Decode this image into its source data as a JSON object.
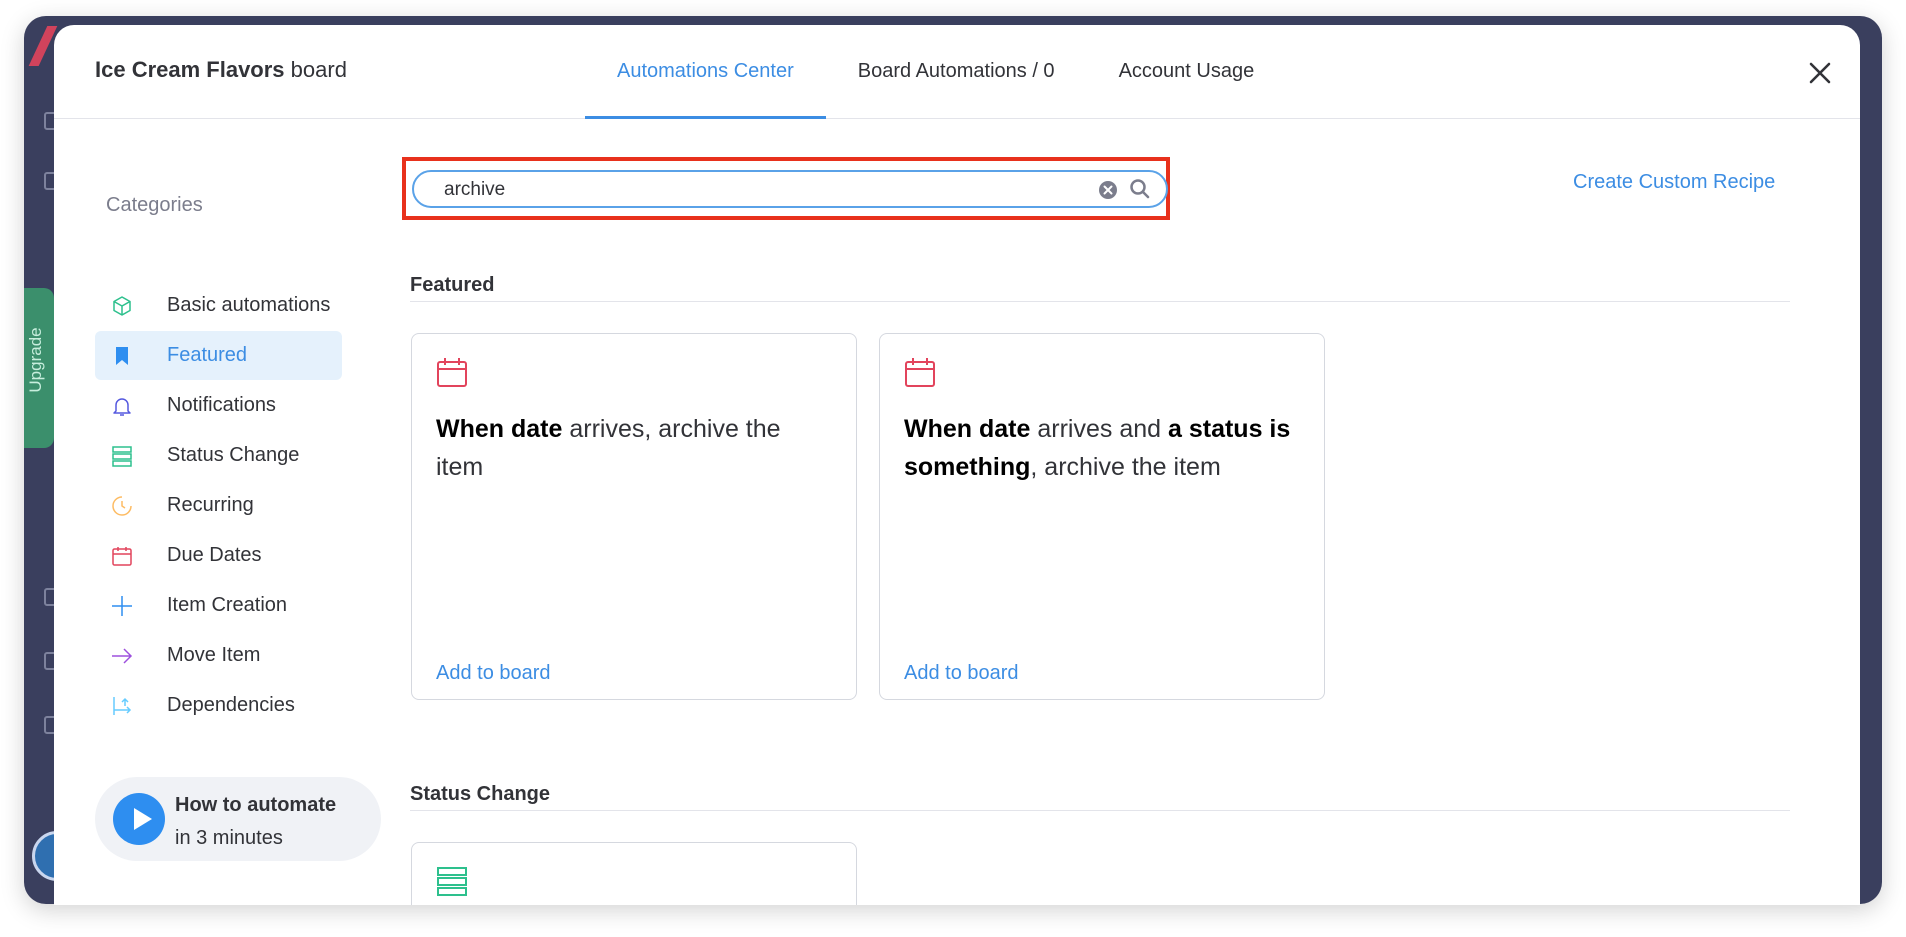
{
  "background_app": {
    "upgrade_label": "Upgrade"
  },
  "header": {
    "board_name": "Ice Cream Flavors",
    "board_suffix": "board",
    "tabs": [
      {
        "label": "Automations Center",
        "active": true
      },
      {
        "label": "Board Automations / 0",
        "active": false
      },
      {
        "label": "Account Usage",
        "active": false
      }
    ]
  },
  "sidebar": {
    "categories_label": "Categories",
    "items": [
      {
        "label": "Basic automations",
        "icon": "cube-icon",
        "color": "#2dc08d"
      },
      {
        "label": "Featured",
        "icon": "bookmark-icon",
        "color": "#2e8ef0",
        "active": true
      },
      {
        "label": "Notifications",
        "icon": "bell-icon",
        "color": "#5559df"
      },
      {
        "label": "Status Change",
        "icon": "status-stack-icon",
        "color": "#2dc08d"
      },
      {
        "label": "Recurring",
        "icon": "clock-icon",
        "color": "#fdbc64"
      },
      {
        "label": "Due Dates",
        "icon": "calendar-icon",
        "color": "#e2445c"
      },
      {
        "label": "Item Creation",
        "icon": "plus-icon",
        "color": "#2e8ef0"
      },
      {
        "label": "Move Item",
        "icon": "arrow-right-icon",
        "color": "#9d50dd"
      },
      {
        "label": "Dependencies",
        "icon": "dependency-icon",
        "color": "#66ccff"
      }
    ],
    "howto": {
      "title": "How to automate",
      "subtitle": "in 3 minutes"
    }
  },
  "search": {
    "value": "archive",
    "placeholder": "Search"
  },
  "create_custom_recipe": "Create Custom Recipe",
  "sections": [
    {
      "title": "Featured",
      "cards": [
        {
          "icon": "calendar-icon",
          "parts": [
            {
              "t": "When ",
              "b": true
            },
            {
              "t": " date ",
              "b": true
            },
            {
              "t": " arrives, archive the item",
              "b": false
            }
          ],
          "add_label": "Add to board"
        },
        {
          "icon": "calendar-icon",
          "parts": [
            {
              "t": "When ",
              "b": true
            },
            {
              "t": " date ",
              "b": true
            },
            {
              "t": " arrives and ",
              "b": false
            },
            {
              "t": "a status ",
              "b": true
            },
            {
              "t": " is ",
              "b": true
            },
            {
              "t": " something",
              "b": true
            },
            {
              "t": ", archive the item",
              "b": false
            }
          ],
          "add_label": "Add to board"
        }
      ]
    },
    {
      "title": "Status Change",
      "cards": [
        {
          "icon": "status-stack-icon",
          "parts": [],
          "add_label": ""
        }
      ]
    }
  ],
  "colors": {
    "accent": "#3c8de3",
    "highlight": "#e8311c",
    "text": "#323338"
  }
}
